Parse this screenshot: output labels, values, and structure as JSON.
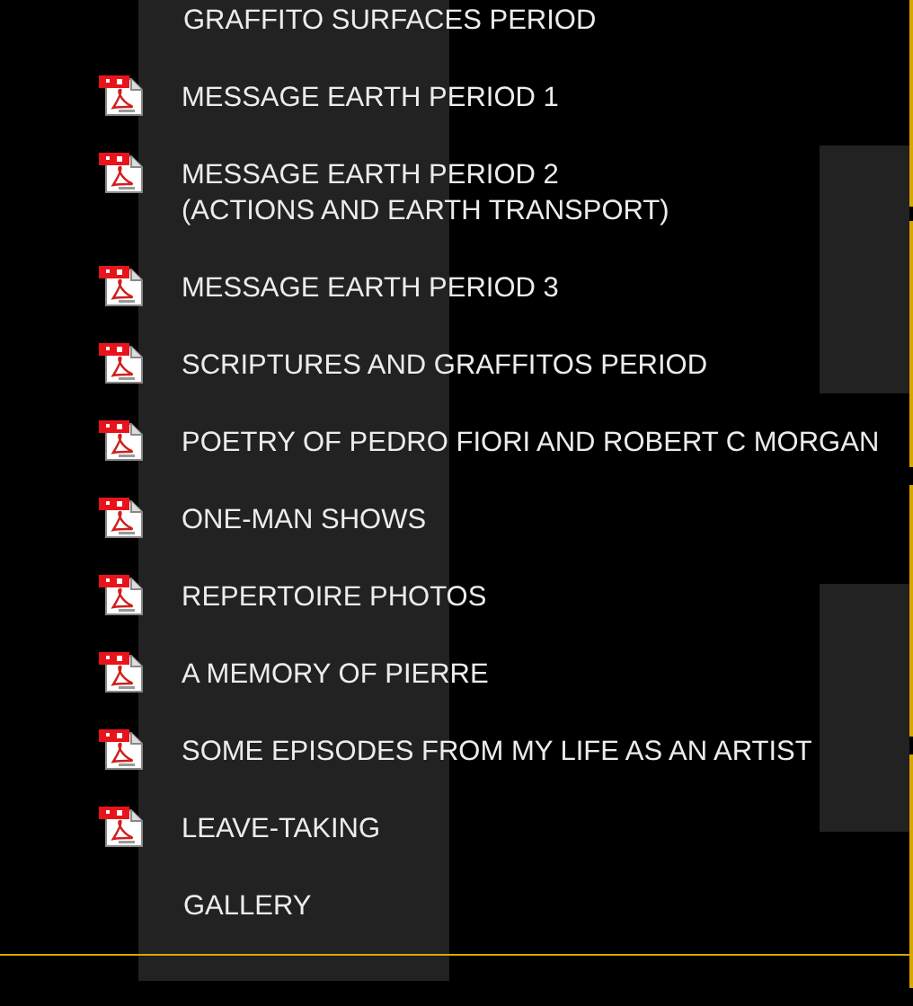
{
  "menu": {
    "items": [
      {
        "kind": "link",
        "lines": [
          "GRAFFITO SURFACES PERIOD"
        ]
      },
      {
        "kind": "pdf",
        "lines": [
          "MESSAGE EARTH PERIOD 1"
        ]
      },
      {
        "kind": "pdf",
        "lines": [
          "MESSAGE EARTH PERIOD 2",
          "(ACTIONS AND EARTH TRANSPORT)"
        ]
      },
      {
        "kind": "pdf",
        "lines": [
          "MESSAGE EARTH PERIOD 3"
        ]
      },
      {
        "kind": "pdf",
        "lines": [
          "SCRIPTURES AND GRAFFITOS PERIOD"
        ]
      },
      {
        "kind": "pdf",
        "lines": [
          "POETRY OF PEDRO FIORI AND ROBERT C MORGAN"
        ]
      },
      {
        "kind": "pdf",
        "lines": [
          "ONE-MAN SHOWS"
        ]
      },
      {
        "kind": "pdf",
        "lines": [
          "REPERTOIRE PHOTOS"
        ]
      },
      {
        "kind": "pdf",
        "lines": [
          "A MEMORY OF PIERRE"
        ]
      },
      {
        "kind": "pdf",
        "lines": [
          "SOME EPISODES FROM MY LIFE AS AN ARTIST"
        ]
      },
      {
        "kind": "pdf",
        "lines": [
          "LEAVE-TAKING"
        ]
      },
      {
        "kind": "link",
        "lines": [
          "GALLERY"
        ]
      }
    ]
  }
}
